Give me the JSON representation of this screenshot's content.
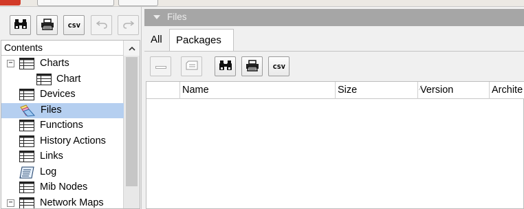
{
  "left_toolbar": {
    "find_icon": "binoculars-icon",
    "print_icon": "printer-icon",
    "csv_label": "csv",
    "undo_icon": "undo-icon",
    "redo_icon": "redo-icon"
  },
  "contents": {
    "header": "Contents",
    "items": [
      {
        "label": "Charts",
        "icon": "table-icon",
        "expand": "−"
      },
      {
        "label": "Chart",
        "icon": "table-icon"
      },
      {
        "label": "Devices",
        "icon": "table-icon"
      },
      {
        "label": "Files",
        "icon": "files-icon",
        "selected": true
      },
      {
        "label": "Functions",
        "icon": "table-icon"
      },
      {
        "label": "History Actions",
        "icon": "table-icon"
      },
      {
        "label": "Links",
        "icon": "table-icon"
      },
      {
        "label": "Log",
        "icon": "log-icon"
      },
      {
        "label": "Mib Nodes",
        "icon": "table-icon"
      },
      {
        "label": "Network Maps",
        "icon": "table-icon",
        "expand": "−"
      }
    ]
  },
  "panel": {
    "title": "Files",
    "tabs": [
      {
        "label": "All",
        "active": false
      },
      {
        "label": "Packages",
        "active": true
      }
    ],
    "toolbar": {
      "remove_icon": "minus-icon",
      "comment_icon": "comment-icon",
      "find_icon": "binoculars-icon",
      "print_icon": "printer-icon",
      "csv_label": "csv"
    },
    "columns": [
      "Name",
      "Size",
      "Version",
      "Archite"
    ]
  },
  "colors": {
    "selection": "#b5cff0",
    "title_bar": "#a6a6a6"
  }
}
